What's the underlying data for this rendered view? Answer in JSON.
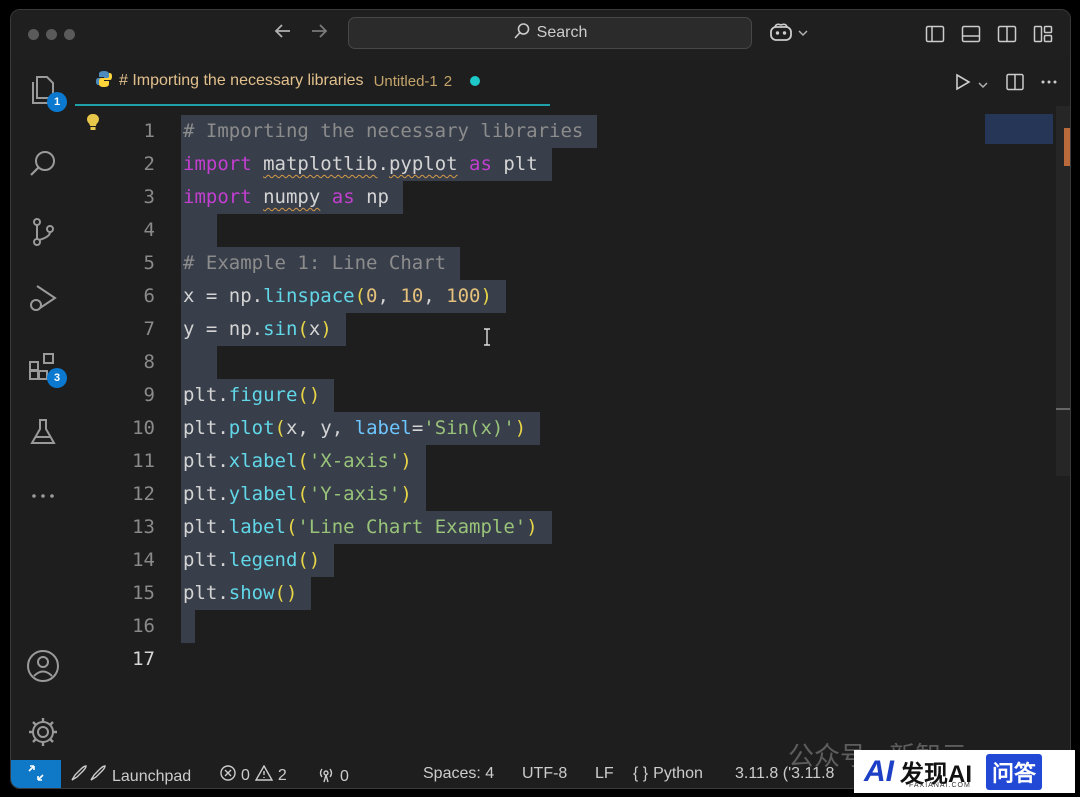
{
  "titlebar": {
    "search_label": "Search",
    "back_icon": "arrow-left-icon",
    "forward_icon": "arrow-right-icon",
    "copilot_icon": "copilot-icon"
  },
  "activity_bar": {
    "explorer_badge": "1",
    "extensions_badge": "3"
  },
  "tab": {
    "name": "# Importing the necessary libraries",
    "file": "Untitled-1",
    "problems": "2"
  },
  "editor": {
    "line_numbers": [
      "1",
      "2",
      "3",
      "4",
      "5",
      "6",
      "7",
      "8",
      "9",
      "10",
      "11",
      "12",
      "13",
      "14",
      "15",
      "16",
      "17"
    ],
    "current_line": "17"
  },
  "statusbar": {
    "launchpad": "Launchpad",
    "errors": "0",
    "warnings": "2",
    "ports": "0",
    "spaces": "Spaces: 4",
    "encoding": "UTF-8",
    "eol": "LF",
    "language_braces": "{ }",
    "language": "Python",
    "interpreter": "3.11.8 ('3.11.8"
  },
  "watermark": {
    "chat_text": "公众号 · 新智元",
    "logo_text": "发现AI",
    "logo_sub": "FAXIANAI.COM",
    "qa_text": "问答",
    "logo_ai": "AI"
  }
}
